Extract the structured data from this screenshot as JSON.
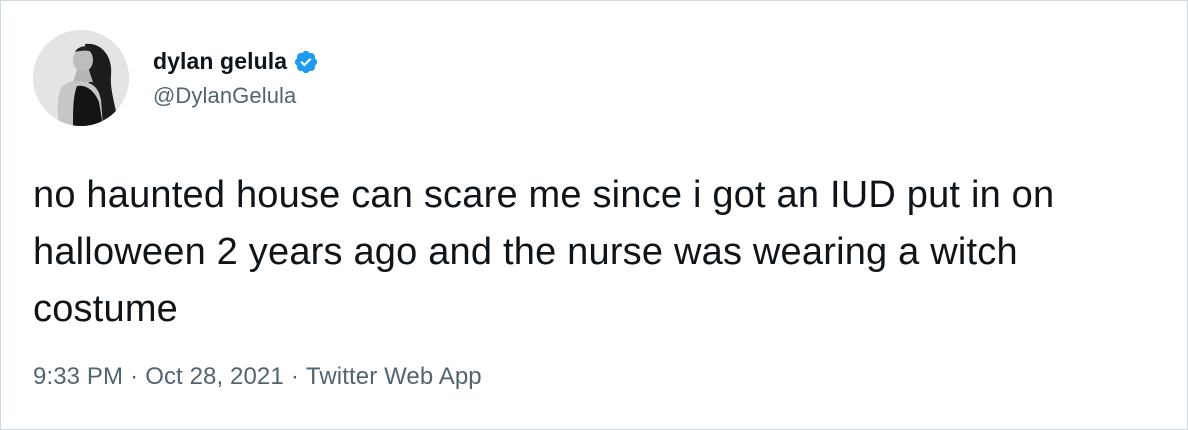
{
  "tweet": {
    "author": {
      "display_name": "dylan gelula",
      "handle": "@DylanGelula",
      "verified": true,
      "avatar_icon": "profile-photo-avatar"
    },
    "text": "no haunted house can scare me since i got an IUD put in on halloween 2 years ago and the nurse was wearing a witch costume",
    "meta": {
      "time": "9:33 PM",
      "date": "Oct 28, 2021",
      "source": "Twitter Web App",
      "separator": "·"
    }
  },
  "colors": {
    "text_primary": "#0f1419",
    "text_secondary": "#536471",
    "verified_blue": "#1d9bf0",
    "border": "#cfd9de"
  }
}
